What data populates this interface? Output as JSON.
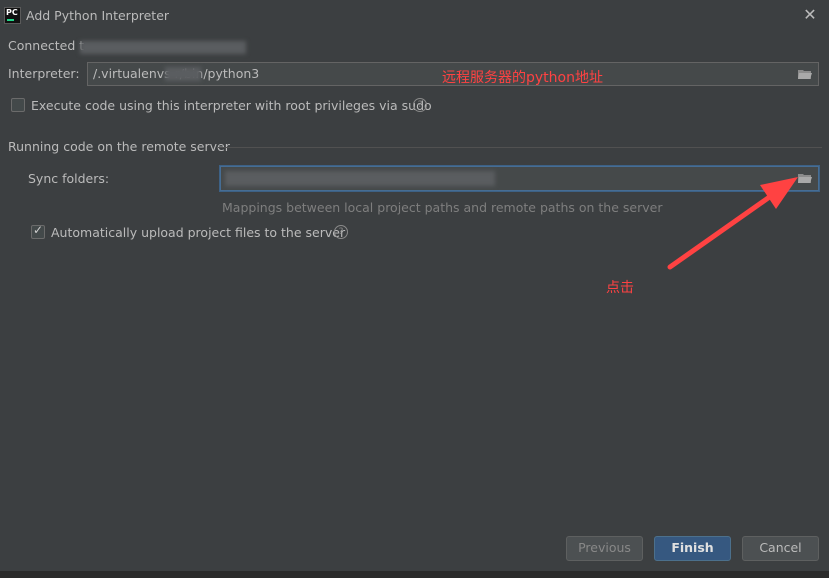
{
  "window": {
    "title": "Add Python Interpreter",
    "app_icon_text": "PC"
  },
  "connection": {
    "label": "Connected t"
  },
  "interpreter": {
    "label": "Interpreter:",
    "value": "/.virtualenvs          r/bin/python3"
  },
  "root_privileges": {
    "label": "Execute code using this interpreter with root privileges via sudo",
    "checked": false
  },
  "remote_section": {
    "title": "Running code on the remote server"
  },
  "sync": {
    "label": "Sync folders:",
    "hint": "Mappings between local project paths and remote paths on the server"
  },
  "auto_upload": {
    "label": "Automatically upload project files to the server",
    "checked": true
  },
  "annotations": {
    "remote_path_note": "远程服务器的python地址",
    "click_note": "点击"
  },
  "buttons": {
    "previous": "Previous",
    "finish": "Finish",
    "cancel": "Cancel"
  },
  "colors": {
    "background": "#3c3f41",
    "annotation": "#ff4242",
    "primary_button": "#365880"
  }
}
